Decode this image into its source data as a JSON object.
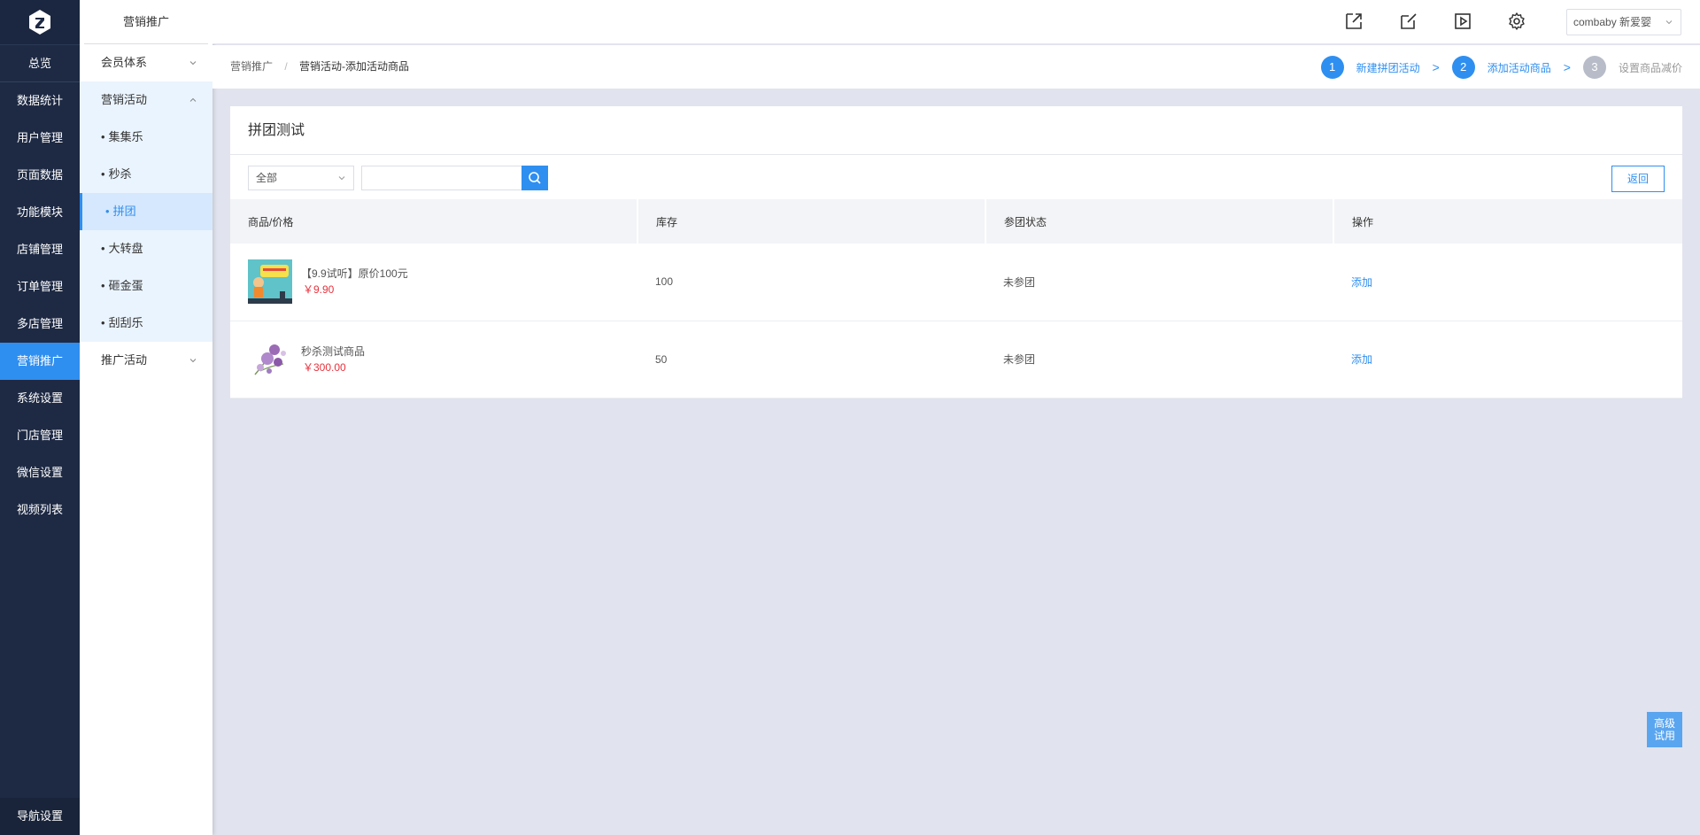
{
  "nav": {
    "items": [
      "总览",
      "数据统计",
      "用户管理",
      "页面数据",
      "功能模块",
      "店铺管理",
      "订单管理",
      "多店管理",
      "营销推广",
      "系统设置",
      "门店管理",
      "微信设置",
      "视频列表"
    ],
    "bottom": "导航设置"
  },
  "subnav": {
    "title": "营销推广",
    "groups": [
      {
        "label": "会员体系"
      },
      {
        "label": "营销活动",
        "children": [
          "集集乐",
          "秒杀",
          "拼团",
          "大转盘",
          "砸金蛋",
          "刮刮乐"
        ]
      },
      {
        "label": "推广活动"
      }
    ]
  },
  "topbar": {
    "store": "combaby 新爱婴"
  },
  "breadcrumb": {
    "parent": "营销推广",
    "current": "营销活动-添加活动商品"
  },
  "steps": [
    {
      "num": "1",
      "label": "新建拼团活动"
    },
    {
      "num": "2",
      "label": "添加活动商品"
    },
    {
      "num": "3",
      "label": "设置商品减价"
    }
  ],
  "card": {
    "title": "拼团测试",
    "filter": "全部",
    "search_value": "",
    "back": "返回"
  },
  "table": {
    "headers": [
      "商品/价格",
      "库存",
      "参团状态",
      "操作"
    ],
    "rows": [
      {
        "name": "【9.9试听】原价100元",
        "price": "￥9.90",
        "stock": "100",
        "status": "未参团",
        "action": "添加"
      },
      {
        "name": "秒杀测试商品",
        "price": "￥300.00",
        "stock": "50",
        "status": "未参团",
        "action": "添加"
      }
    ]
  },
  "float": {
    "line1": "高级",
    "line2": "试用"
  },
  "colors": {
    "primary": "#2f8ff0",
    "nav_bg": "#1e2a44",
    "price": "#e8323c"
  }
}
